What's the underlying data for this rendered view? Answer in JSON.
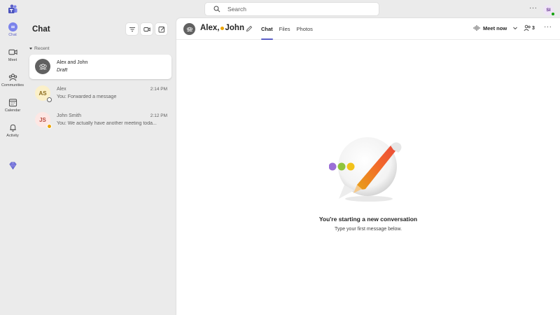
{
  "topbar": {
    "search_placeholder": "Search",
    "more": "···",
    "user_initials": "SI"
  },
  "rail": {
    "items": [
      {
        "label": "Chat",
        "icon": "chat-icon",
        "active": true
      },
      {
        "label": "Meet",
        "icon": "video-icon"
      },
      {
        "label": "Communities",
        "icon": "communities-icon"
      },
      {
        "label": "Calendar",
        "icon": "calendar-icon"
      },
      {
        "label": "Activity",
        "icon": "bell-icon"
      }
    ],
    "extra_icon": "premium-diamond-icon"
  },
  "chatlist": {
    "title": "Chat",
    "section": "Recent",
    "conversations": [
      {
        "name": "Alex and John",
        "preview": "Draft",
        "time": "",
        "initials": "",
        "selected": true
      },
      {
        "name": "Alex",
        "preview": "You: Forwarded a message",
        "time": "2:14 PM",
        "initials": "AS",
        "status": "offline"
      },
      {
        "name": "John Smith",
        "preview": "You: We actually have another meeting toda...",
        "time": "2:12 PM",
        "initials": "JS",
        "status": "away"
      }
    ]
  },
  "main": {
    "title_first": "Alex",
    "title_comma": ",",
    "title_second": "John",
    "tabs": [
      "Chat",
      "Files",
      "Photos"
    ],
    "meet_now": "Meet now",
    "participants": "3",
    "more": "···",
    "empty_title": "You're starting a new conversation",
    "empty_subtitle": "Type your first message below."
  },
  "colors": {
    "accent": "#5b5fc7",
    "away": "#eaa300",
    "available": "#13a10e",
    "as_avatar_bg": "#fbf0c9",
    "as_avatar_fg": "#8a6a1a",
    "js_avatar_bg": "#fde7e4",
    "js_avatar_fg": "#b94a3e"
  }
}
